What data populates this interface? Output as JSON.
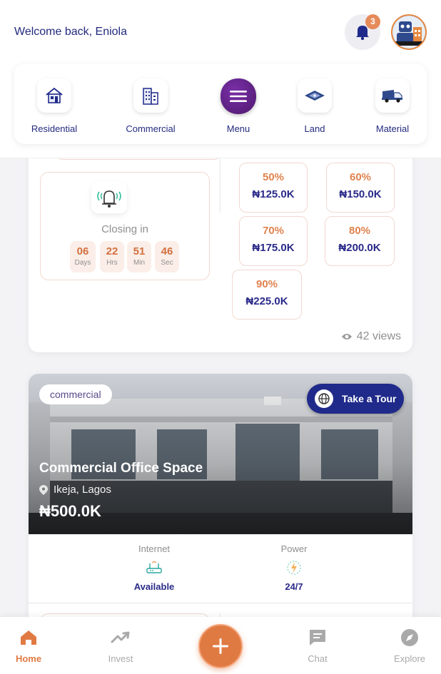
{
  "header": {
    "welcome": "Welcome back, Eniola",
    "notification_count": "3"
  },
  "categories": [
    {
      "label": "Residential",
      "icon": "house-icon"
    },
    {
      "label": "Commercial",
      "icon": "office-building-icon"
    },
    {
      "label": "Menu",
      "icon": "hamburger-menu-icon"
    },
    {
      "label": "Land",
      "icon": "land-plot-icon"
    },
    {
      "label": "Material",
      "icon": "truck-icon"
    }
  ],
  "auction": {
    "closing_label": "Closing in",
    "timer": [
      {
        "value": "06",
        "unit": "Days"
      },
      {
        "value": "22",
        "unit": "Hrs"
      },
      {
        "value": "51",
        "unit": "Min"
      },
      {
        "value": "46",
        "unit": "Sec"
      }
    ],
    "installments": [
      {
        "percent": "50%",
        "amount": "₦125.0K"
      },
      {
        "percent": "60%",
        "amount": "₦150.0K"
      },
      {
        "percent": "70%",
        "amount": "₦175.0K"
      },
      {
        "percent": "80%",
        "amount": "₦200.0K"
      },
      {
        "percent": "90%",
        "amount": "₦225.0K"
      }
    ],
    "views": "42 views"
  },
  "listing": {
    "tag": "commercial",
    "tour_label": "Take a Tour",
    "title": "Commercial Office Space",
    "location": "Ikeja, Lagos",
    "price": "₦500.0K",
    "features": [
      {
        "label": "Internet",
        "value": "Available",
        "icon": "router-icon"
      },
      {
        "label": "Power",
        "value": "24/7",
        "icon": "lightning-icon"
      }
    ]
  },
  "bottom_nav": [
    {
      "label": "Home",
      "icon": "home-icon",
      "active": true
    },
    {
      "label": "Invest",
      "icon": "trending-up-icon",
      "active": false
    },
    {
      "label": "Chat",
      "icon": "chat-icon",
      "active": false
    },
    {
      "label": "Explore",
      "icon": "compass-icon",
      "active": false
    }
  ],
  "colors": {
    "accent": "#e07a43",
    "brand_navy": "#232a7e",
    "tour_button": "#1f2a8a"
  }
}
